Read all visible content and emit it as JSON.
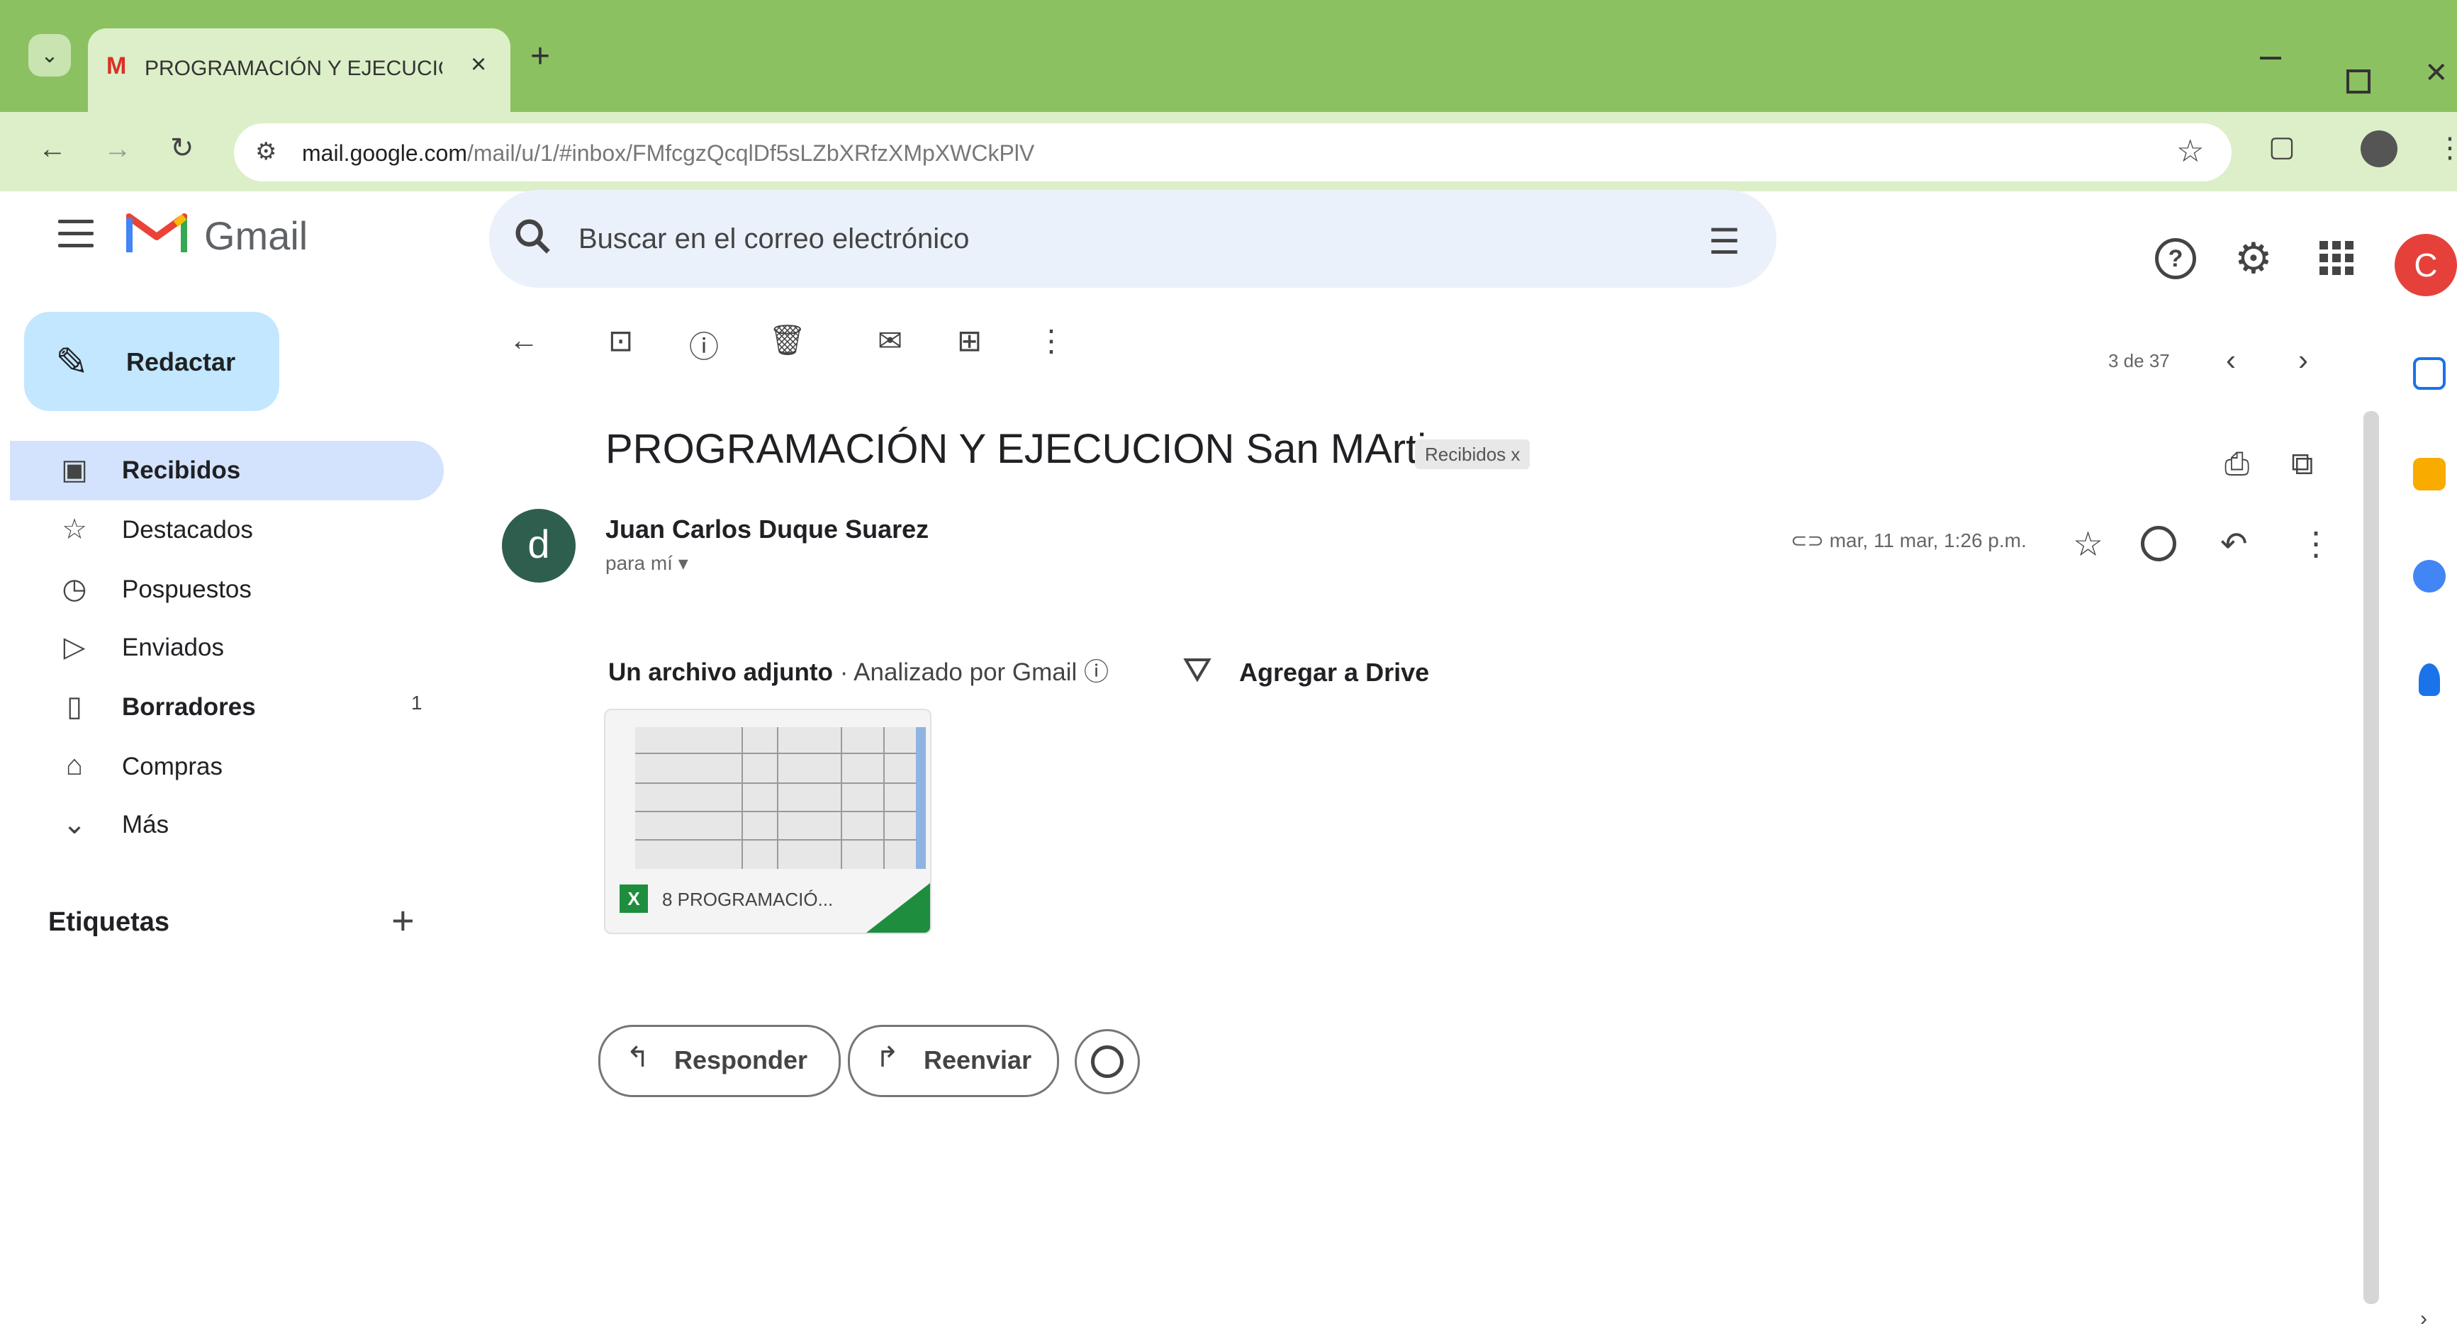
{
  "browser": {
    "tab_title": "PROGRAMACIÓN Y EJECUCIO",
    "tab_favicon": "M",
    "tab_close": "×",
    "new_tab": "+",
    "url_host": "mail.google.com",
    "url_path": "/mail/u/1/#inbox/FMfcgzQcqlDf5sLZbXRfzXMpXWCkPlV",
    "nav": {
      "back": "←",
      "forward": "→",
      "reload": "↻"
    },
    "icons": [
      "tab-list-icon",
      "site-info-icon",
      "bookmark-star-icon",
      "extensions-icon",
      "profile-icon",
      "browser-menu-icon"
    ]
  },
  "gmail": {
    "brand": "Gmail",
    "search": {
      "placeholder": "Buscar en el correo electrónico"
    },
    "account_initial": "C",
    "colors": {
      "compose_bg": "#c2e7ff",
      "active_nav_bg": "#d3e3fd",
      "account": "#e5413a",
      "chrome_green": "#8cc162"
    }
  },
  "sidebar": {
    "compose_label": "Redactar",
    "items": [
      {
        "icon": "inbox-icon",
        "glyph": "▣",
        "label": "Recibidos",
        "active": true,
        "bold": true,
        "count": ""
      },
      {
        "icon": "star-icon",
        "glyph": "☆",
        "label": "Destacados",
        "count": ""
      },
      {
        "icon": "snoozed-icon",
        "glyph": "◷",
        "label": "Pospuestos",
        "count": ""
      },
      {
        "icon": "sent-icon",
        "glyph": "▷",
        "label": "Enviados",
        "count": ""
      },
      {
        "icon": "draft-icon",
        "glyph": "▯",
        "label": "Borradores",
        "bold": true,
        "count": "1"
      },
      {
        "icon": "purchases-icon",
        "glyph": "⌂",
        "label": "Compras",
        "count": ""
      },
      {
        "icon": "chevron-down-icon",
        "glyph": "⌄",
        "label": "Más",
        "count": ""
      }
    ],
    "labels_title": "Etiquetas",
    "labels_add": "+"
  },
  "toolbar": {
    "back": "←",
    "archive": "⊡",
    "spam": "ⓘ",
    "delete": "🗑",
    "mark_unread": "✉",
    "move": "⊞",
    "more": "⋮",
    "pager": "3 de 37",
    "prev": "‹",
    "next": "›"
  },
  "message": {
    "subject": "PROGRAMACIÓN Y EJECUCION San MArtin",
    "label_chip": "Recibidos x",
    "sender_initial": "d",
    "sender_name": "Juan Carlos Duque Suarez",
    "recipient": "para mí ▾",
    "date": "mar, 11 mar, 1:26 p.m.",
    "attachment_summary": "Un archivo adjunto",
    "scanned_by": "· Analizado por Gmail ⓘ",
    "add_to_drive": "Agregar a Drive",
    "attachment_name": "8 PROGRAMACIÓ...",
    "attachment_type_letter": "X",
    "reply_label": "Responder",
    "forward_label": "Reenviar"
  }
}
